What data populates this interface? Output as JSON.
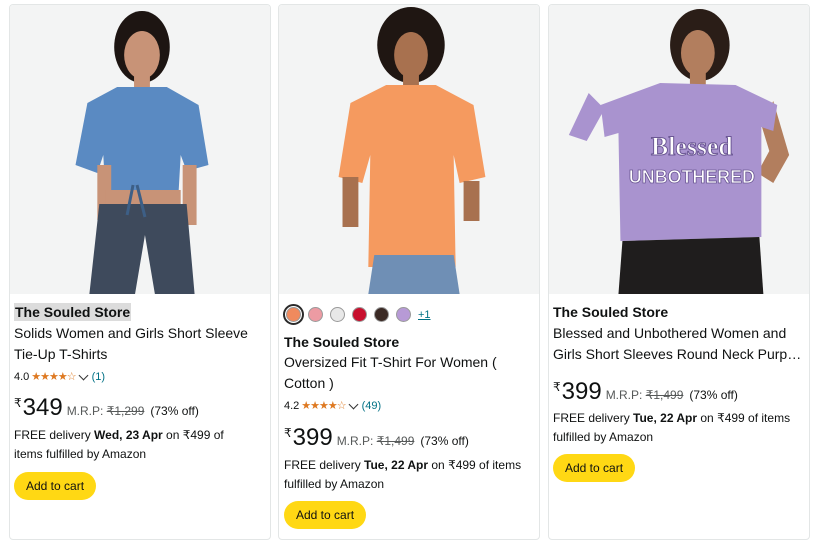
{
  "products": [
    {
      "brand": "The Souled Store",
      "title_lines": [
        "Solids Women and Girls Short Sleeve",
        "Tie-Up T-Shirts"
      ],
      "rating": "4.0",
      "stars": "★★★★☆",
      "review_count": "(1)",
      "currency": "₹",
      "price": "349",
      "mrp_label": "M.R.P:",
      "mrp": "₹1,299",
      "discount": "(73% off)",
      "delivery_prefix": "FREE delivery ",
      "delivery_date": "Wed, 23 Apr",
      "delivery_suffix": " on ₹499 of items fulfilled by Amazon",
      "cart_label": "Add to cart",
      "shirt_color": "#5a8ac2"
    },
    {
      "brand": "The Souled Store",
      "title_lines": [
        "Oversized Fit T-Shirt For Women (",
        "Cotton )"
      ],
      "rating": "4.2",
      "stars": "★★★★☆",
      "review_count": "(49)",
      "currency": "₹",
      "price": "399",
      "mrp_label": "M.R.P:",
      "mrp": "₹1,499",
      "discount": "(73% off)",
      "delivery_prefix": "FREE delivery ",
      "delivery_date": "Tue, 22 Apr",
      "delivery_suffix": " on ₹499 of items fulfilled by Amazon",
      "cart_label": "Add to cart",
      "shirt_color": "#f59a5f",
      "swatches": [
        "#f08a5d",
        "#ec9ba3",
        "#e8e8e8",
        "#c8102e",
        "#3b2a25",
        "#b79ad6"
      ],
      "more_colors": "+1"
    },
    {
      "brand": "The Souled Store",
      "title_lines": [
        "Blessed and Unbothered Women and",
        "Girls Short Sleeves Round Neck Purp…"
      ],
      "currency": "₹",
      "price": "399",
      "mrp_label": "M.R.P:",
      "mrp": "₹1,499",
      "discount": "(73% off)",
      "delivery_prefix": "FREE delivery ",
      "delivery_date": "Tue, 22 Apr",
      "delivery_suffix": " on ₹499 of items fulfilled by Amazon",
      "cart_label": "Add to cart",
      "shirt_color": "#a993cf",
      "print_lines": [
        "Blessed",
        "UNBOTHERED"
      ]
    }
  ]
}
